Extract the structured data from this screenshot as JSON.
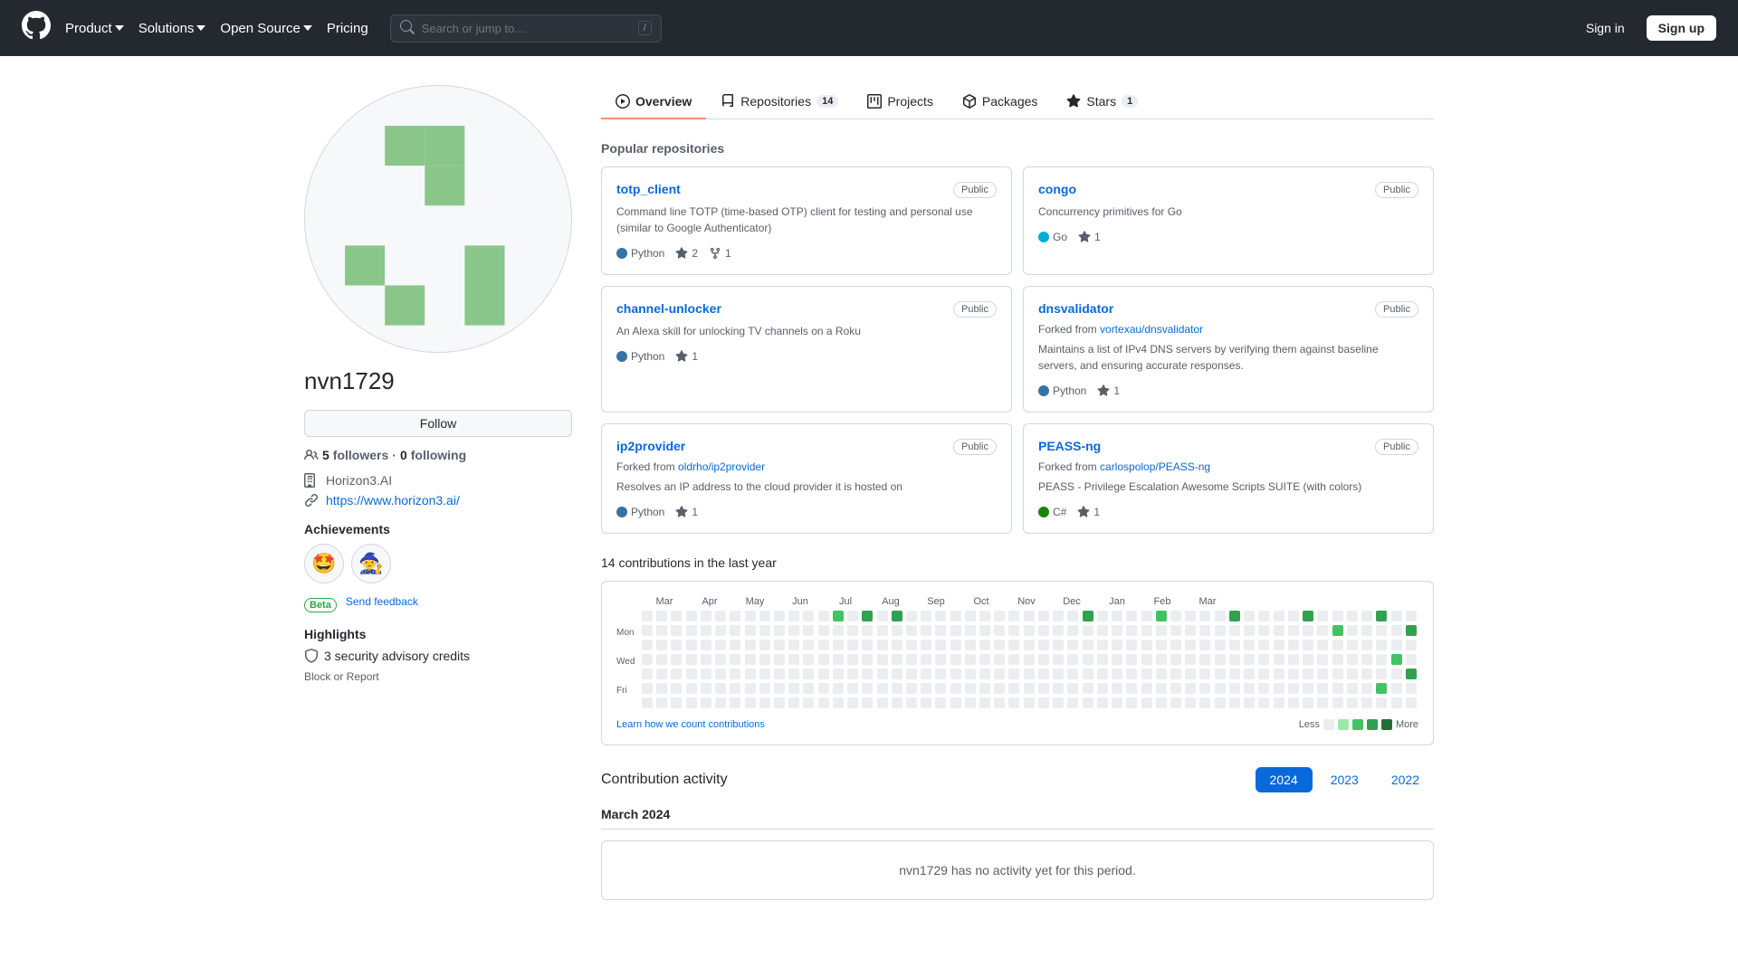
{
  "nav": {
    "logo_label": "GitHub",
    "product_label": "Product",
    "solutions_label": "Solutions",
    "open_source_label": "Open Source",
    "pricing_label": "Pricing",
    "search_placeholder": "Search or jump to...",
    "sign_in_label": "Sign in",
    "sign_up_label": "Sign up",
    "kbd_slash": "/"
  },
  "tabs": [
    {
      "id": "overview",
      "label": "Overview",
      "icon": "overview-icon",
      "active": true
    },
    {
      "id": "repositories",
      "label": "Repositories",
      "badge": "14",
      "icon": "repo-icon"
    },
    {
      "id": "projects",
      "label": "Projects",
      "icon": "projects-icon"
    },
    {
      "id": "packages",
      "label": "Packages",
      "icon": "packages-icon"
    },
    {
      "id": "stars",
      "label": "Stars",
      "badge": "1",
      "icon": "stars-icon"
    }
  ],
  "sidebar": {
    "username": "nvn1729",
    "follow_button": "Follow",
    "followers_count": "5",
    "followers_label": "followers",
    "following_dot": "·",
    "following_count": "0",
    "following_label": "following",
    "org_name": "Horizon3.AI",
    "website": "https://www.horizon3.ai/",
    "achievements_title": "Achievements",
    "achievement_1_emoji": "🤩",
    "achievement_2_emoji": "🧙",
    "beta_label": "Beta",
    "send_feedback_label": "Send feedback",
    "highlights_title": "Highlights",
    "security_advisory": "3 security advisory credits",
    "block_report": "Block or Report"
  },
  "popular_repos": {
    "section_title": "Popular repositories",
    "repos": [
      {
        "name": "totp_client",
        "visibility": "Public",
        "description": "Command line TOTP (time-based OTP) client for testing and personal use (similar to Google Authenticator)",
        "lang": "Python",
        "lang_color": "#3572A5",
        "stars": "2",
        "forks": "1",
        "forked": false
      },
      {
        "name": "congo",
        "visibility": "Public",
        "description": "Concurrency primitives for Go",
        "lang": "Go",
        "lang_color": "#00ADD8",
        "stars": "1",
        "forks": "",
        "forked": false
      },
      {
        "name": "channel-unlocker",
        "visibility": "Public",
        "description": "An Alexa skill for unlocking TV channels on a Roku",
        "lang": "Python",
        "lang_color": "#3572A5",
        "stars": "1",
        "forks": "",
        "forked": false
      },
      {
        "name": "dnsvalidator",
        "visibility": "Public",
        "description": "Maintains a list of IPv4 DNS servers by verifying them against baseline servers, and ensuring accurate responses.",
        "lang": "Python",
        "lang_color": "#3572A5",
        "stars": "1",
        "forked": true,
        "fork_from": "vortexau/dnsvalidator"
      },
      {
        "name": "ip2provider",
        "visibility": "Public",
        "description": "Resolves an IP address to the cloud provider it is hosted on",
        "lang": "Python",
        "lang_color": "#3572A5",
        "stars": "1",
        "forked": true,
        "fork_from": "oldrho/ip2provider"
      },
      {
        "name": "PEASS-ng",
        "visibility": "Public",
        "description": "PEASS - Privilege Escalation Awesome Scripts SUITE (with colors)",
        "lang": "C#",
        "lang_color": "#178600",
        "stars": "1",
        "forked": true,
        "fork_from": "carlospolop/PEASS-ng"
      }
    ]
  },
  "contrib_graph": {
    "title": "14 contributions in the last year",
    "months": [
      "Mar",
      "Apr",
      "May",
      "Jun",
      "Jul",
      "Aug",
      "Sep",
      "Oct",
      "Nov",
      "Dec",
      "Jan",
      "Feb",
      "Mar"
    ],
    "day_labels": [
      "",
      "Mon",
      "",
      "Wed",
      "",
      "Fri",
      ""
    ],
    "learn_link": "Learn how we count contributions",
    "less_label": "Less",
    "more_label": "More"
  },
  "activity": {
    "title": "Contribution activity",
    "years": [
      "2024",
      "2023",
      "2022"
    ],
    "active_year": "2024",
    "period": "March 2024",
    "no_activity_msg": "nvn1729 has no activity yet for this period."
  }
}
